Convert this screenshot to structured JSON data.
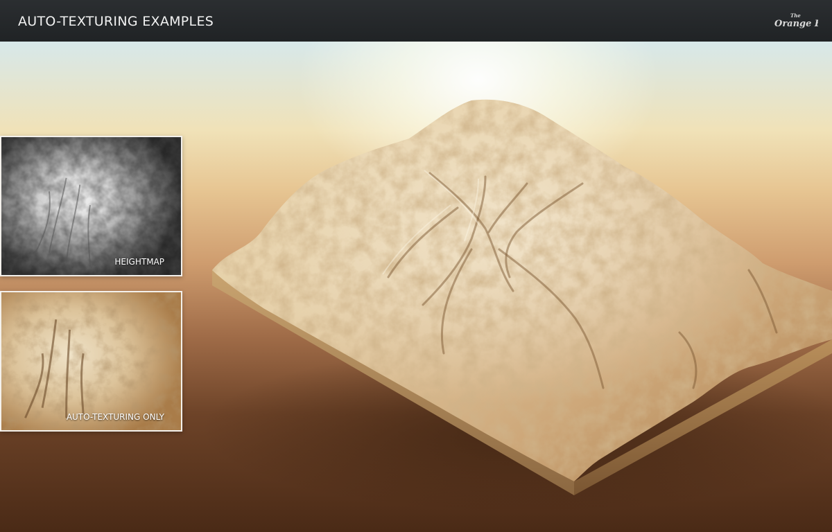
{
  "header": {
    "title": "AUTO-TEXTURING EXAMPLES",
    "logo_text": "The Orange Box"
  },
  "thumbnails": [
    {
      "label": "HEIGHTMAP"
    },
    {
      "label": "AUTO-TEXTURING ONLY"
    }
  ],
  "colors": {
    "header_bg": "#26292c",
    "sand_light": "#e8d6b4",
    "sand_dark": "#a77b4a",
    "base_side": "#b8905f"
  }
}
